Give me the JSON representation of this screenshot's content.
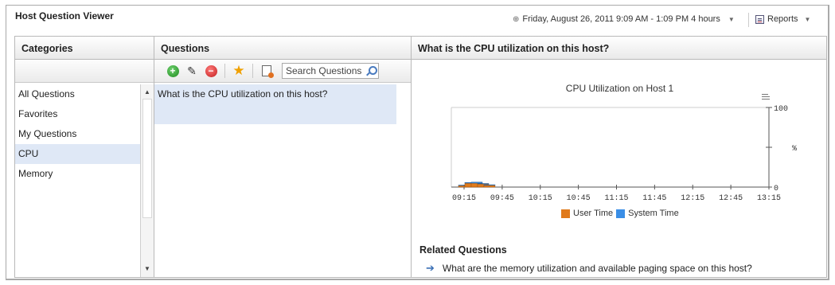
{
  "window": {
    "title": "Host Question Viewer",
    "time_range": "Friday, August 26, 2011 9:09 AM - 1:09 PM 4 hours",
    "reports_label": "Reports"
  },
  "panes": {
    "categories_header": "Categories",
    "questions_header": "Questions",
    "detail_header": "What is the CPU utilization on this host?"
  },
  "categories": {
    "items": [
      {
        "label": "All Questions",
        "selected": false
      },
      {
        "label": "Favorites",
        "selected": false
      },
      {
        "label": "My Questions",
        "selected": false
      },
      {
        "label": "CPU",
        "selected": true
      },
      {
        "label": "Memory",
        "selected": false
      }
    ]
  },
  "questions": {
    "search_placeholder": "Search Questions",
    "items": [
      {
        "label": "What is the CPU utilization on this host?",
        "selected": true
      }
    ]
  },
  "related": {
    "title": "Related Questions",
    "items": [
      "What are the memory utilization and available paging space on this host?"
    ]
  },
  "colors": {
    "user_time": "#e07a1b",
    "system_time": "#3a8ee6",
    "selection": "#dfe8f6"
  },
  "icons": [
    "add-icon",
    "edit-icon",
    "remove-icon",
    "favorite-star-icon",
    "report-icon",
    "search-icon",
    "reports-icon",
    "clock-icon",
    "chart-menu-icon"
  ],
  "chart_data": {
    "type": "bar",
    "title": "CPU Utilization on Host 1",
    "ylabel": "%",
    "ylim": [
      0,
      100
    ],
    "ytick_labels": [
      "0",
      "100"
    ],
    "x_tick_labels": [
      "09:15",
      "09:45",
      "10:15",
      "10:45",
      "11:15",
      "11:45",
      "12:15",
      "12:45",
      "13:15"
    ],
    "stacked": true,
    "categories": [
      "09:15",
      "09:20",
      "09:25",
      "09:30",
      "09:35"
    ],
    "series": [
      {
        "name": "User Time",
        "values": [
          2.0,
          5.0,
          5.0,
          4.0,
          2.5
        ]
      },
      {
        "name": "System Time",
        "values": [
          0.5,
          0.7,
          1.2,
          0.5,
          0.4
        ]
      }
    ],
    "legend": "bottom"
  }
}
